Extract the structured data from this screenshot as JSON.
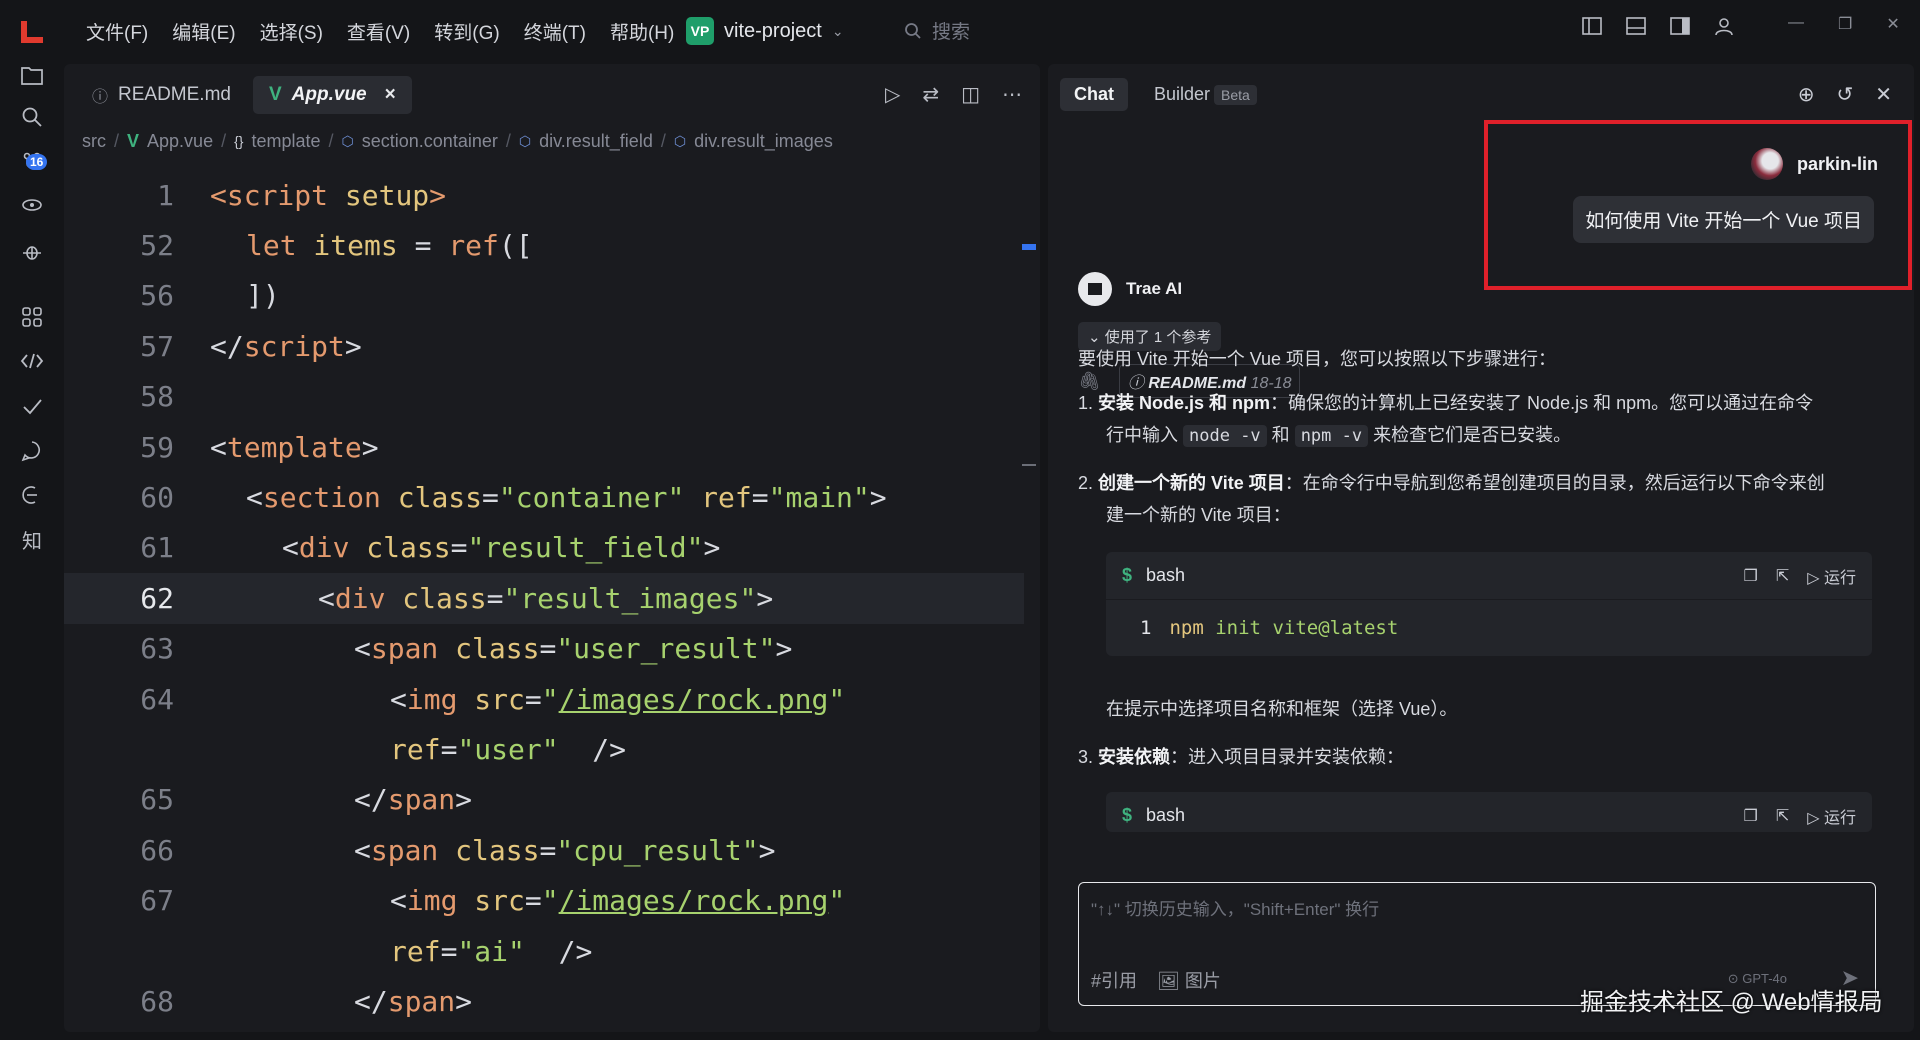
{
  "menu": [
    "文件(F)",
    "编辑(E)",
    "选择(S)",
    "查看(V)",
    "转到(G)",
    "终端(T)",
    "帮助(H)"
  ],
  "project": {
    "badge": "VP",
    "name": "vite-project"
  },
  "search": {
    "placeholder": "搜索"
  },
  "activity": {
    "badge": "16"
  },
  "editor": {
    "tabs": [
      {
        "label": "README.md",
        "icon": "info-circle-icon"
      },
      {
        "label": "App.vue",
        "icon": "vue-icon",
        "close": "×"
      }
    ],
    "breadcrumb": [
      "src",
      "App.vue",
      "template",
      "section.container",
      "div.result_field",
      "div.result_images"
    ],
    "lines": [
      {
        "n": "1"
      },
      {
        "n": "52"
      },
      {
        "n": "56"
      },
      {
        "n": "57"
      },
      {
        "n": "58"
      },
      {
        "n": "59"
      },
      {
        "n": "60"
      },
      {
        "n": "61"
      },
      {
        "n": "62"
      },
      {
        "n": "63"
      },
      {
        "n": "64"
      },
      {
        "n": ""
      },
      {
        "n": "65"
      },
      {
        "n": "66"
      },
      {
        "n": "67"
      },
      {
        "n": ""
      },
      {
        "n": "68"
      }
    ],
    "code": {
      "l1a": "<script",
      "l1b": " setup",
      "l1c": ">",
      "l52a": "let",
      "l52b": " items",
      "l52c": " = ",
      "l52d": "ref",
      "l52e": "([",
      "l56": "])",
      "l57a": "</",
      "l57b": "script",
      "l57c": ">",
      "l59a": "<",
      "l59b": "template",
      "l59c": ">",
      "l60a": "<",
      "l60b": "section",
      "l60c": " class",
      "l60d": "=",
      "l60e": "\"container\"",
      "l60f": " ref",
      "l60g": "=",
      "l60h": "\"main\"",
      "l60i": ">",
      "l61a": "<",
      "l61b": "div",
      "l61c": " class",
      "l61d": "=",
      "l61e": "\"result_field\"",
      "l61f": ">",
      "l62a": "<",
      "l62b": "div",
      "l62c": " class",
      "l62d": "=",
      "l62e": "\"result_images\"",
      "l62f": ">",
      "l63a": "<",
      "l63b": "span",
      "l63c": " class",
      "l63d": "=",
      "l63e": "\"user_result\"",
      "l63f": ">",
      "l64a": "<",
      "l64b": "img",
      "l64c": " src",
      "l64d": "=",
      "l64e": "\"",
      "l64f": "/images/rock.png",
      "l64g": "\"",
      "l64ba": "ref",
      "l64bb": "=",
      "l64bc": "\"user\"",
      "l64bd": "  />",
      "l65a": "</",
      "l65b": "span",
      "l65c": ">",
      "l66a": "<",
      "l66b": "span",
      "l66c": " class",
      "l66d": "=",
      "l66e": "\"cpu_result\"",
      "l66f": ">",
      "l67a": "<",
      "l67b": "img",
      "l67c": " src",
      "l67d": "=",
      "l67e": "\"",
      "l67f": "/images/rock.png",
      "l67g": "\"",
      "l67ba": "ref",
      "l67bb": "=",
      "l67bc": "\"ai\"",
      "l67bd": "  />",
      "l68a": "</",
      "l68b": "span",
      "l68c": ">"
    }
  },
  "chat": {
    "tabs": {
      "chat": "Chat",
      "builder": "Builder",
      "beta": "Beta"
    },
    "user": {
      "name": "parkin-lin",
      "message": "如何使用 Vite 开始一个 Vue 项目"
    },
    "ai": {
      "name": "Trae AI"
    },
    "refs_label": "使用了 1 个参考",
    "ref_file": {
      "name": "README.md",
      "range": "18-18"
    },
    "intro": "要使用 Vite 开始一个 Vue 项目，您可以按照以下步骤进行：",
    "steps": {
      "s1_num": "1.",
      "s1_bold": "安装 Node.js 和 npm",
      "s1_text": "：确保您的计算机上已经安装了 Node.js 和 npm。您可以通过在命令",
      "s1_text2a": "行中输入 ",
      "s1_code1": "node -v",
      "s1_text2b": " 和 ",
      "s1_code2": "npm -v",
      "s1_text2c": " 来检查它们是否已安装。",
      "s2_num": "2.",
      "s2_bold": "创建一个新的 Vite 项目",
      "s2_text": "：在命令行中导航到您希望创建项目的目录，然后运行以下命令来创",
      "s2_text2": "建一个新的 Vite 项目：",
      "s2_note": "在提示中选择项目名称和框架（选择 Vue）。",
      "s3_num": "3.",
      "s3_bold": "安装依赖",
      "s3_text": "：进入项目目录并安装依赖："
    },
    "codeblock": {
      "dollar": "$",
      "lang": "bash",
      "run": "运行",
      "line_no": "1",
      "cmd1": "npm",
      "cmd2": "init",
      "cmd3": "vite@latest"
    },
    "codeblock2": {
      "dollar": "$",
      "lang": "bash",
      "run": "运行"
    },
    "input": {
      "placeholder": "\"↑↓\" 切换历史输入，\"Shift+Enter\" 换行",
      "ref_tool": "引用",
      "image_tool": "图片",
      "model": "GPT-4o"
    }
  },
  "watermark": "掘金技术社区 @ Web情报局"
}
